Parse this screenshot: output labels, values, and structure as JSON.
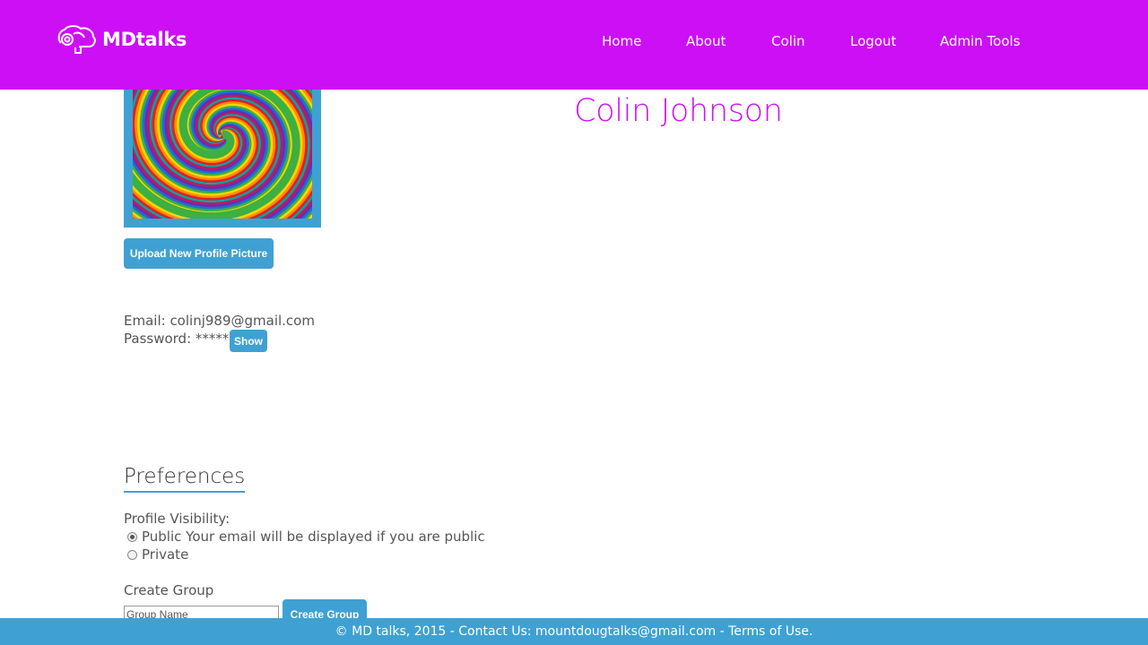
{
  "header": {
    "brand": "MDtalks",
    "nav": [
      {
        "label": "Home"
      },
      {
        "label": "About"
      },
      {
        "label": "Colin"
      },
      {
        "label": "Logout"
      },
      {
        "label": "Admin Tools"
      }
    ],
    "colors": {
      "background": "#cc0ff5"
    }
  },
  "profile": {
    "name": "Colin Johnson",
    "upload_button": "Upload New Profile Picture",
    "email_line": "Email: colinj989@gmail.com",
    "password_line": "Password: *****",
    "show_button": "Show"
  },
  "preferences": {
    "heading": "Preferences",
    "visibility_label": "Profile Visibility:",
    "options": [
      {
        "label": "Public Your email will be displayed if you are public",
        "checked": true
      },
      {
        "label": "Private",
        "checked": false
      }
    ]
  },
  "create_group": {
    "label": "Create Group",
    "input_placeholder": "Group Name",
    "input_value": "",
    "button": "Create Group"
  },
  "footer": {
    "text": "© MD talks, 2015 - Contact Us: mountdougtalks@gmail.com - Terms of Use."
  },
  "theme": {
    "accent": "#3fa1d3",
    "brand": "#cc0ff5"
  }
}
